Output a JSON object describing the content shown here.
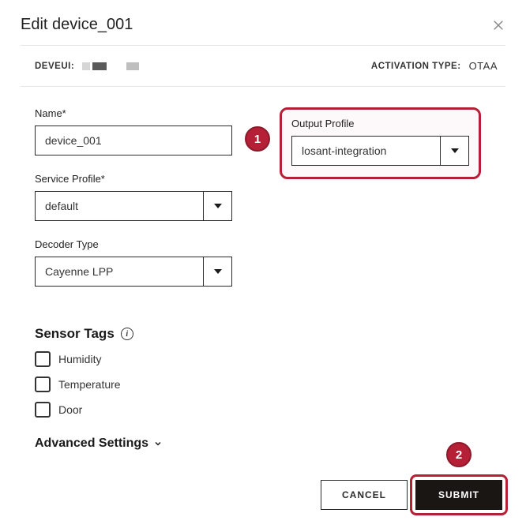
{
  "header": {
    "title": "Edit device_001"
  },
  "meta": {
    "deveui_label": "DEVEUI:",
    "activation_label": "ACTIVATION TYPE:",
    "activation_value": "OTAA"
  },
  "fields": {
    "name": {
      "label": "Name*",
      "value": "device_001"
    },
    "service_profile": {
      "label": "Service Profile*",
      "value": "default"
    },
    "decoder_type": {
      "label": "Decoder Type",
      "value": "Cayenne LPP"
    },
    "output_profile": {
      "label": "Output Profile",
      "value": "losant-integration"
    }
  },
  "sensor_tags": {
    "title": "Sensor Tags",
    "items": [
      {
        "label": "Humidity",
        "checked": false
      },
      {
        "label": "Temperature",
        "checked": false
      },
      {
        "label": "Door",
        "checked": false
      }
    ]
  },
  "advanced": {
    "title": "Advanced Settings"
  },
  "buttons": {
    "cancel": "CANCEL",
    "submit": "SUBMIT"
  },
  "callouts": {
    "one": "1",
    "two": "2"
  }
}
